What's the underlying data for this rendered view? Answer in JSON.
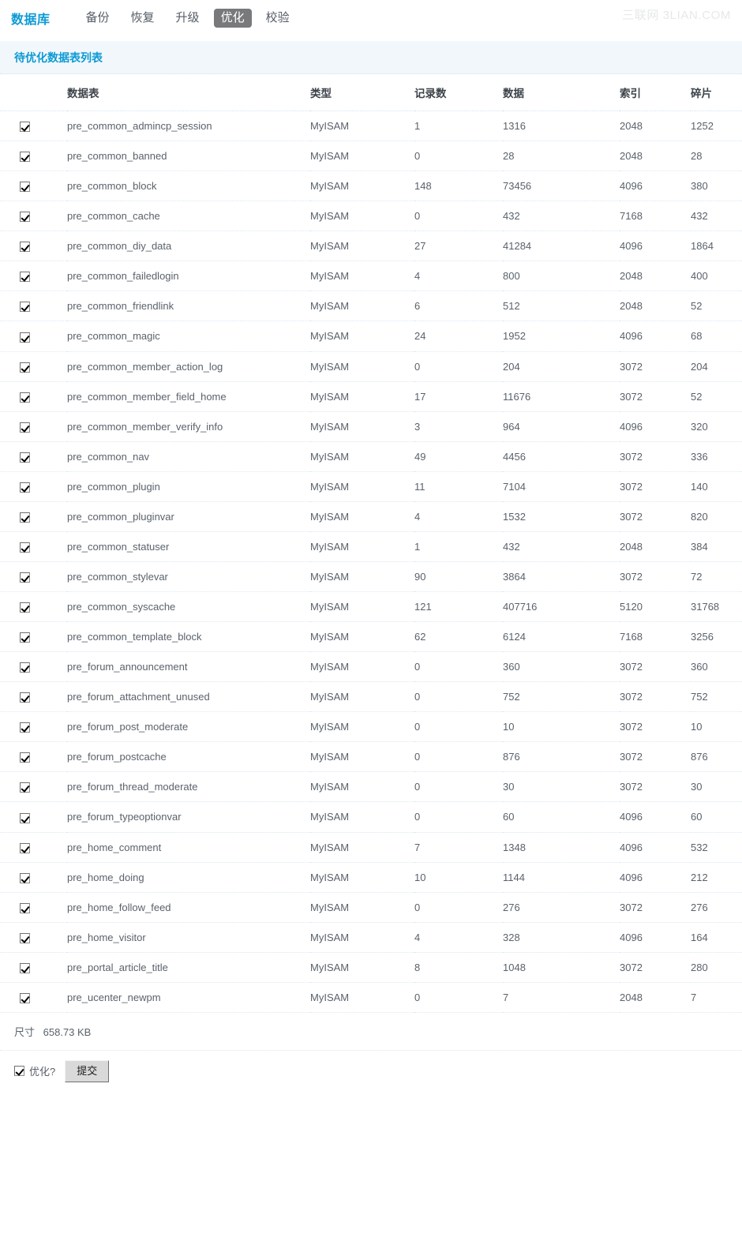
{
  "nav": {
    "brand": "数据库",
    "items": [
      {
        "label": "备份",
        "active": false
      },
      {
        "label": "恢复",
        "active": false
      },
      {
        "label": "升级",
        "active": false
      },
      {
        "label": "优化",
        "active": true
      },
      {
        "label": "校验",
        "active": false
      }
    ],
    "watermark": "三联网 3LIAN.COM"
  },
  "panel": {
    "title": "待优化数据表列表"
  },
  "table": {
    "columns": [
      "",
      "数据表",
      "类型",
      "记录数",
      "数据",
      "索引",
      "碎片"
    ],
    "rows": [
      {
        "checked": true,
        "name": "pre_common_admincp_session",
        "type": "MyISAM",
        "rows": "1",
        "data": "1316",
        "index": "2048",
        "frag": "1252"
      },
      {
        "checked": true,
        "name": "pre_common_banned",
        "type": "MyISAM",
        "rows": "0",
        "data": "28",
        "index": "2048",
        "frag": "28"
      },
      {
        "checked": true,
        "name": "pre_common_block",
        "type": "MyISAM",
        "rows": "148",
        "data": "73456",
        "index": "4096",
        "frag": "380"
      },
      {
        "checked": true,
        "name": "pre_common_cache",
        "type": "MyISAM",
        "rows": "0",
        "data": "432",
        "index": "7168",
        "frag": "432"
      },
      {
        "checked": true,
        "name": "pre_common_diy_data",
        "type": "MyISAM",
        "rows": "27",
        "data": "41284",
        "index": "4096",
        "frag": "1864"
      },
      {
        "checked": true,
        "name": "pre_common_failedlogin",
        "type": "MyISAM",
        "rows": "4",
        "data": "800",
        "index": "2048",
        "frag": "400"
      },
      {
        "checked": true,
        "name": "pre_common_friendlink",
        "type": "MyISAM",
        "rows": "6",
        "data": "512",
        "index": "2048",
        "frag": "52"
      },
      {
        "checked": true,
        "name": "pre_common_magic",
        "type": "MyISAM",
        "rows": "24",
        "data": "1952",
        "index": "4096",
        "frag": "68"
      },
      {
        "checked": true,
        "name": "pre_common_member_action_log",
        "type": "MyISAM",
        "rows": "0",
        "data": "204",
        "index": "3072",
        "frag": "204"
      },
      {
        "checked": true,
        "name": "pre_common_member_field_home",
        "type": "MyISAM",
        "rows": "17",
        "data": "11676",
        "index": "3072",
        "frag": "52"
      },
      {
        "checked": true,
        "name": "pre_common_member_verify_info",
        "type": "MyISAM",
        "rows": "3",
        "data": "964",
        "index": "4096",
        "frag": "320"
      },
      {
        "checked": true,
        "name": "pre_common_nav",
        "type": "MyISAM",
        "rows": "49",
        "data": "4456",
        "index": "3072",
        "frag": "336"
      },
      {
        "checked": true,
        "name": "pre_common_plugin",
        "type": "MyISAM",
        "rows": "11",
        "data": "7104",
        "index": "3072",
        "frag": "140"
      },
      {
        "checked": true,
        "name": "pre_common_pluginvar",
        "type": "MyISAM",
        "rows": "4",
        "data": "1532",
        "index": "3072",
        "frag": "820"
      },
      {
        "checked": true,
        "name": "pre_common_statuser",
        "type": "MyISAM",
        "rows": "1",
        "data": "432",
        "index": "2048",
        "frag": "384"
      },
      {
        "checked": true,
        "name": "pre_common_stylevar",
        "type": "MyISAM",
        "rows": "90",
        "data": "3864",
        "index": "3072",
        "frag": "72"
      },
      {
        "checked": true,
        "name": "pre_common_syscache",
        "type": "MyISAM",
        "rows": "121",
        "data": "407716",
        "index": "5120",
        "frag": "31768"
      },
      {
        "checked": true,
        "name": "pre_common_template_block",
        "type": "MyISAM",
        "rows": "62",
        "data": "6124",
        "index": "7168",
        "frag": "3256"
      },
      {
        "checked": true,
        "name": "pre_forum_announcement",
        "type": "MyISAM",
        "rows": "0",
        "data": "360",
        "index": "3072",
        "frag": "360"
      },
      {
        "checked": true,
        "name": "pre_forum_attachment_unused",
        "type": "MyISAM",
        "rows": "0",
        "data": "752",
        "index": "3072",
        "frag": "752"
      },
      {
        "checked": true,
        "name": "pre_forum_post_moderate",
        "type": "MyISAM",
        "rows": "0",
        "data": "10",
        "index": "3072",
        "frag": "10"
      },
      {
        "checked": true,
        "name": "pre_forum_postcache",
        "type": "MyISAM",
        "rows": "0",
        "data": "876",
        "index": "3072",
        "frag": "876"
      },
      {
        "checked": true,
        "name": "pre_forum_thread_moderate",
        "type": "MyISAM",
        "rows": "0",
        "data": "30",
        "index": "3072",
        "frag": "30"
      },
      {
        "checked": true,
        "name": "pre_forum_typeoptionvar",
        "type": "MyISAM",
        "rows": "0",
        "data": "60",
        "index": "4096",
        "frag": "60"
      },
      {
        "checked": true,
        "name": "pre_home_comment",
        "type": "MyISAM",
        "rows": "7",
        "data": "1348",
        "index": "4096",
        "frag": "532"
      },
      {
        "checked": true,
        "name": "pre_home_doing",
        "type": "MyISAM",
        "rows": "10",
        "data": "1144",
        "index": "4096",
        "frag": "212"
      },
      {
        "checked": true,
        "name": "pre_home_follow_feed",
        "type": "MyISAM",
        "rows": "0",
        "data": "276",
        "index": "3072",
        "frag": "276"
      },
      {
        "checked": true,
        "name": "pre_home_visitor",
        "type": "MyISAM",
        "rows": "4",
        "data": "328",
        "index": "4096",
        "frag": "164"
      },
      {
        "checked": true,
        "name": "pre_portal_article_title",
        "type": "MyISAM",
        "rows": "8",
        "data": "1048",
        "index": "3072",
        "frag": "280"
      },
      {
        "checked": true,
        "name": "pre_ucenter_newpm",
        "type": "MyISAM",
        "rows": "0",
        "data": "7",
        "index": "2048",
        "frag": "7"
      }
    ]
  },
  "footer": {
    "size_label": "尺寸",
    "size_value": "658.73 KB",
    "optimize_label": "优化?",
    "submit_label": "提交"
  },
  "colors": {
    "brand": "#0d9ad4",
    "active_tab_bg": "#78797b",
    "panel_bg": "#f2f7fc",
    "row_divider": "#dbe8f3",
    "text": "#5a626b"
  }
}
